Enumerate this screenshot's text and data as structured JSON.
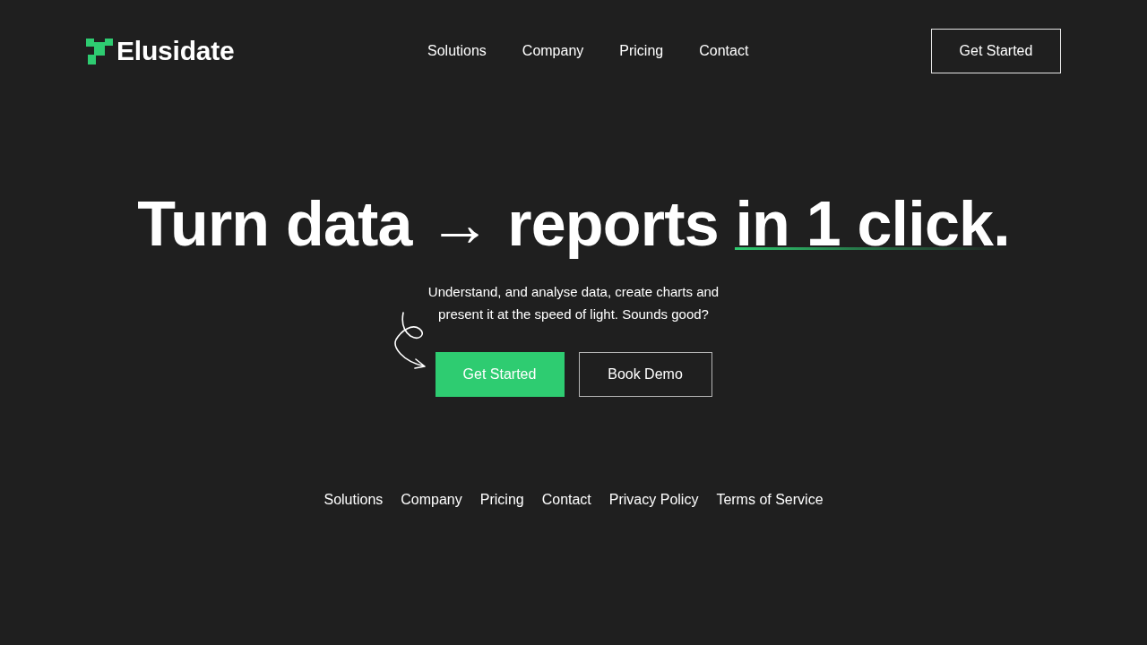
{
  "header": {
    "logo": {
      "name": "Elusidate"
    },
    "nav": [
      "Solutions",
      "Company",
      "Pricing",
      "Contact"
    ],
    "cta": "Get Started"
  },
  "hero": {
    "headline": {
      "text": "Turn data → reports",
      "highlight": "in 1 click."
    },
    "subtitle": "Understand, and analyse data, create charts and present it at the speed of light. Sounds good?",
    "buttons": [
      {
        "label": "Get Started",
        "kind": "primary"
      },
      {
        "label": "Book Demo",
        "kind": "secondary"
      }
    ]
  },
  "footer": {
    "links": [
      "Solutions",
      "Company",
      "Pricing",
      "Contact",
      "Privacy Policy",
      "Terms of Service"
    ]
  }
}
